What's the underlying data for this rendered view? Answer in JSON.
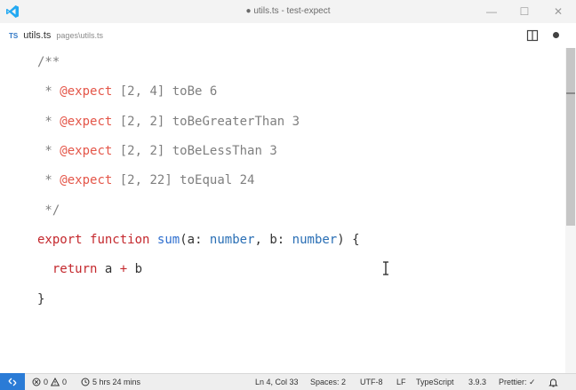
{
  "window": {
    "title": "● utils.ts - test-expect",
    "minimize_glyph": "—",
    "maximize_glyph": "☐",
    "close_glyph": "✕"
  },
  "tab": {
    "lang_badge": "TS",
    "filename": "utils.ts",
    "path": "pages\\utils.ts"
  },
  "editor": {
    "lines": [
      "/**",
      " * @expect [2, 4] toBe 6",
      " * @expect [2, 2] toBeGreaterThan 3",
      " * @expect [2, 2] toBeLessThan 3",
      " * @expect [2, 22] toEqual 24",
      " */",
      "export function sum(a: number, b: number) {",
      "  return a + b",
      "}"
    ],
    "tokens": {
      "comment_open": "/**",
      "comment_star": " * ",
      "comment_close": " */",
      "tag": "@expect",
      "expect_1": " [2, 4] toBe 6",
      "expect_2": " [2, 2] toBeGreaterThan 3",
      "expect_3": " [2, 2] toBeLessThan 3",
      "expect_4": " [2, 22] toEqual 24",
      "kw_export": "export",
      "kw_function": "function",
      "fn_name": "sum",
      "param_a": "a",
      "param_b": "b",
      "type_number": "number",
      "kw_return": "return",
      "op_plus": "+",
      "brace_close": "}"
    }
  },
  "statusbar": {
    "errors": "0",
    "warnings": "0",
    "time_tracked": "5 hrs 24 mins",
    "cursor_position": "Ln 4, Col 33",
    "indentation": "Spaces: 2",
    "encoding": "UTF-8",
    "eol": "LF",
    "language": "TypeScript",
    "ts_version": "3.9.3",
    "prettier": "Prettier: ✓"
  },
  "colors": {
    "accent": "#2a7bd6",
    "keyword": "#c4282d",
    "function": "#2f6fcf",
    "comment": "#7f7f7f",
    "tag": "#e45649"
  }
}
